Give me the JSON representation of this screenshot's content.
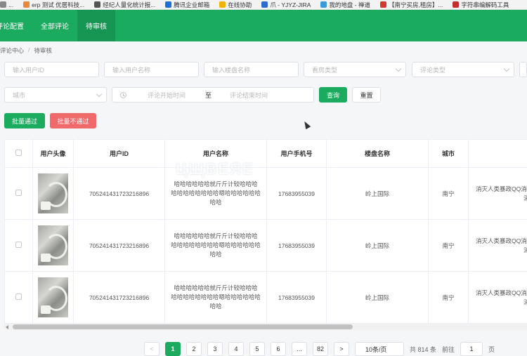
{
  "bookmarks": [
    {
      "label": "...",
      "color": "#888888"
    },
    {
      "label": "erp 测试 优居科技...",
      "color": "#e8883a"
    },
    {
      "label": "经纪人量化统计报...",
      "color": "#555555"
    },
    {
      "label": "腾讯企业邮箱",
      "color": "#1f6fd6"
    },
    {
      "label": "在线协助",
      "color": "#f0b400"
    },
    {
      "label": "爪 - YJYZ-JIRA",
      "color": "#2e6bd1"
    },
    {
      "label": "我的地盘 - 禅道",
      "color": "#3a9ad9"
    },
    {
      "label": "【南宁买房,租房】...",
      "color": "#d23a2e"
    },
    {
      "label": "字符串编解码工具",
      "color": "#c4302b"
    }
  ],
  "nav": {
    "tabs": [
      "评论配置",
      "全部评论",
      "待审核"
    ],
    "active_index": 2
  },
  "breadcrumb": [
    "评论中心",
    "/",
    "待审核"
  ],
  "filters": {
    "user_id_placeholder": "输入用户ID",
    "user_name_placeholder": "输入用户名称",
    "building_placeholder": "输入楼盘名称",
    "viewing_type_placeholder": "看房类型",
    "comment_type_placeholder": "评论类型",
    "city_placeholder": "城市",
    "start_time_placeholder": "评论开始时间",
    "range_separator": "至",
    "end_time_placeholder": "评论结束时间",
    "query_label": "查询",
    "reset_label": "重置"
  },
  "actions": {
    "batch_pass": "批量通过",
    "batch_reject": "批量不通过"
  },
  "table": {
    "headers": [
      "用户头像",
      "用户ID",
      "用户名称",
      "用户手机号",
      "楼盘名称",
      "城市"
    ],
    "rows": [
      {
        "user_id": "705241431723216896",
        "name_line1": "哈哈哈哈哈哈就斤斤计较哈哈哈",
        "name_line2": "哈哈哈哈哈哈哈哈嗯哈哈哈哈哈哈",
        "name_line3": "哈哈",
        "phone": "17683955039",
        "building": "岭上国际",
        "city": "南宁",
        "extra_line1": "消灭人类暴政QQ消灭",
        "extra_line2": "消"
      },
      {
        "user_id": "705241431723216896",
        "name_line1": "哈哈哈哈哈哈就斤斤计较哈哈哈",
        "name_line2": "哈哈哈哈哈哈哈哈嗯哈哈哈哈哈哈",
        "name_line3": "哈哈",
        "phone": "17683955039",
        "building": "岭上国际",
        "city": "南宁",
        "extra_line1": "消灭人类暴政QQ消灭",
        "extra_line2": "消"
      },
      {
        "user_id": "705241431723216896",
        "name_line1": "哈哈哈哈哈哈就斤斤计较哈哈哈",
        "name_line2": "哈哈哈哈哈哈哈哈嗯哈哈哈哈哈哈",
        "name_line3": "哈哈",
        "phone": "17683955039",
        "building": "岭上国际",
        "city": "南宁",
        "extra_line1": "消灭人类暴政QQ消灭",
        "extra_line2": "消"
      }
    ]
  },
  "watermark": "ЦЩВЕЯЕ",
  "pagination": {
    "prev": "<",
    "pages": [
      "1",
      "2",
      "3",
      "4",
      "5",
      "6",
      "...",
      "82"
    ],
    "current": "1",
    "next": ">",
    "page_size": "10条/页",
    "total": "共 814 条",
    "goto_label": "前往",
    "goto_value": "1",
    "page_unit": "页"
  },
  "colors": {
    "brand_green": "#1bab5e",
    "reject_red": "#f06a6a"
  }
}
